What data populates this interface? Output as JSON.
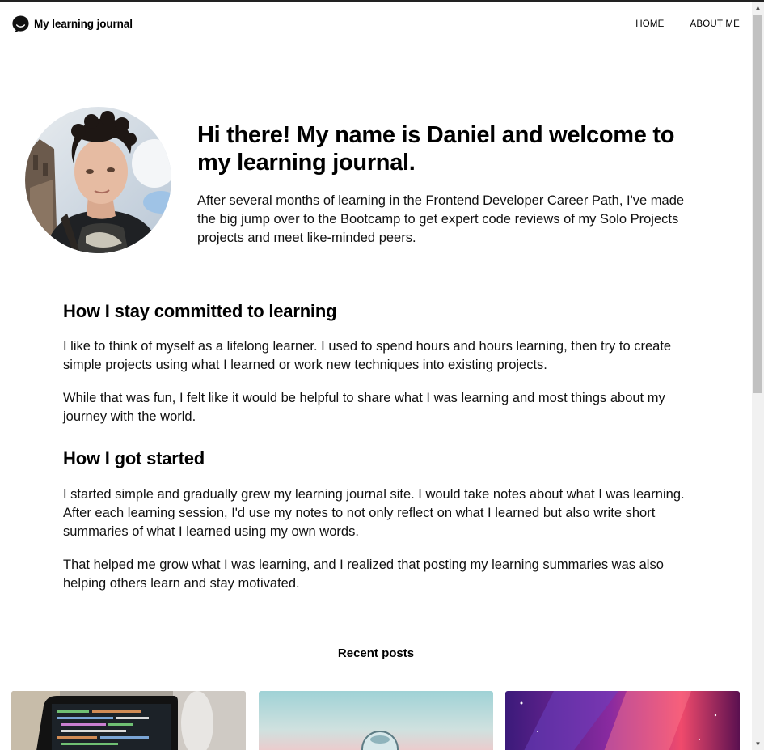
{
  "header": {
    "brand": "My learning journal",
    "brand_icon": "chat-bubble-icon",
    "nav": [
      "HOME",
      "ABOUT ME"
    ]
  },
  "hero": {
    "avatar_alt": "profile-photo",
    "title": "Hi there! My name is Daniel and welcome to my learning journal.",
    "text": "After several months of learning in the Frontend Developer Career Path, I've made the big jump over to the Bootcamp to get expert code reviews of my Solo Projects projects and meet like-minded peers."
  },
  "sections": [
    {
      "title": "How I stay committed to learning",
      "paragraphs": [
        "I like to think of myself as a lifelong learner. I used to spend hours and hours learning, then try to create simple projects using what I learned or work new techniques into existing projects.",
        "While that was fun, I felt like it would be helpful to share what I was learning and most things about my journey with the world."
      ]
    },
    {
      "title": "How I got started",
      "paragraphs": [
        "I started simple and gradually grew my learning journal site. I would take notes about what I was learning. After each learning session, I'd use my notes to not only reflect on what I learned but also write short summaries of what I learned using my own words.",
        "That helped me grow what I was learning, and I realized that posting my learning summaries was also helping others learn and stay motivated."
      ]
    }
  ],
  "recent": {
    "title": "Recent posts"
  },
  "colors": {
    "text": "#000000",
    "background": "#ffffff",
    "scrollbar_thumb": "#c1c1c1"
  }
}
